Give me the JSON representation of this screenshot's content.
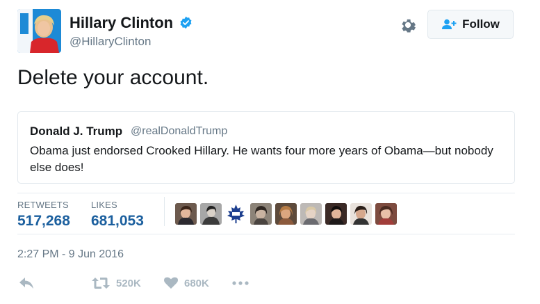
{
  "profile": {
    "display_name": "Hillary Clinton",
    "handle": "@HillaryClinton",
    "verified": true,
    "avatar_icon": "hillary-avatar"
  },
  "header": {
    "follow_label": "Follow",
    "settings_icon": "gear-icon",
    "follow_icon": "add-user-icon"
  },
  "tweet": {
    "text": "Delete your account."
  },
  "quoted_tweet": {
    "display_name": "Donald J. Trump",
    "handle": "@realDonaldTrump",
    "text": "Obama just endorsed Crooked Hillary. He wants four more years of Obama—but nobody else does!"
  },
  "stats": {
    "retweets_label": "RETWEETS",
    "retweets_value": "517,268",
    "likes_label": "LIKES",
    "likes_value": "681,053",
    "liker_avatars": [
      "avatar-1",
      "avatar-2",
      "maple-leafs-logo",
      "avatar-4",
      "avatar-5",
      "avatar-6",
      "avatar-7",
      "avatar-8",
      "avatar-9"
    ]
  },
  "timestamp": "2:27 PM - 9 Jun 2016",
  "actions": {
    "reply_icon": "reply-icon",
    "retweet_icon": "retweet-icon",
    "retweet_count": "520K",
    "like_icon": "heart-icon",
    "like_count": "680K",
    "more_icon": "more-icon"
  },
  "colors": {
    "accent": "#1b95e0",
    "stat_blue": "#1b5f9e",
    "muted": "#657786",
    "action_gray": "#aab8c2"
  }
}
